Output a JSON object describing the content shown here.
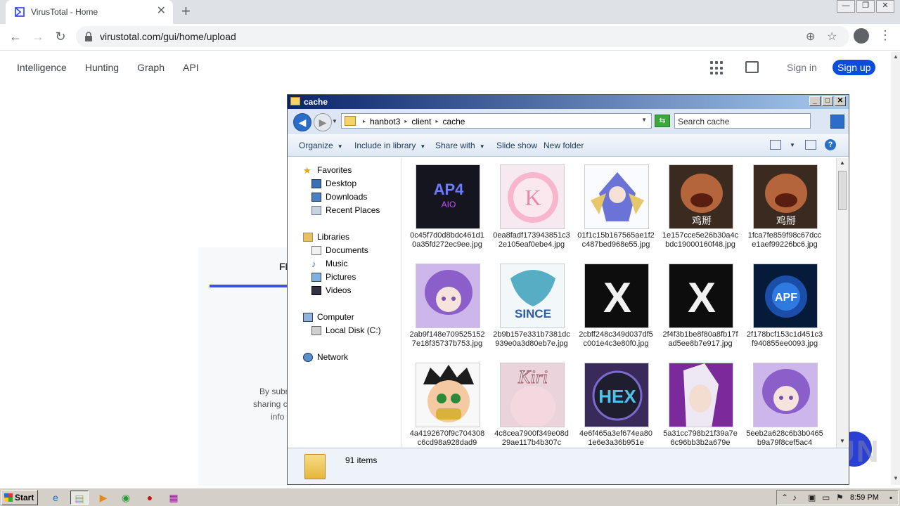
{
  "browser": {
    "tab_title": "VirusTotal - Home",
    "url": "virustotal.com/gui/home/upload"
  },
  "vt": {
    "nav": [
      "Intelligence",
      "Hunting",
      "Graph",
      "API"
    ],
    "signin": "Sign in",
    "signup": "Sign up",
    "card_heading": "FI",
    "text_lines": [
      "By subm",
      "sharing c",
      "info"
    ]
  },
  "explorer": {
    "title": "cache",
    "breadcrumb": [
      "hanbot3",
      "client",
      "cache"
    ],
    "search_placeholder": "Search cache",
    "commands": {
      "organize": "Organize",
      "include": "Include in library",
      "share": "Share with",
      "slideshow": "Slide show",
      "new_folder": "New folder"
    },
    "nav": {
      "favorites": "Favorites",
      "desktop": "Desktop",
      "downloads": "Downloads",
      "recent": "Recent Places",
      "libraries": "Libraries",
      "documents": "Documents",
      "music": "Music",
      "pictures": "Pictures",
      "videos": "Videos",
      "computer": "Computer",
      "local_disk": "Local Disk (C:)",
      "network": "Network"
    },
    "files": [
      {
        "name": "0c45f7d0d8bdc461d10a35fd272ec9ee.jpg",
        "thumb_text": "AP4"
      },
      {
        "name": "0ea8fadf173943851c32e105eaf0ebe4.jpg",
        "thumb_text": "K"
      },
      {
        "name": "01f1c15b167565ae1f2c487bed968e55.jpg",
        "thumb_text": ""
      },
      {
        "name": "1e157cce5e26b30a4cbdc19000160f48.jpg",
        "thumb_text": "鸡掰"
      },
      {
        "name": "1fca7fe859f98c67dcce1aef99226bc6.jpg",
        "thumb_text": "鸡掰"
      },
      {
        "name": "2ab9f148e7095251527e18f35737b753.jpg",
        "thumb_text": ""
      },
      {
        "name": "2b9b157e331b7381dc939e0a3d80eb7e.jpg",
        "thumb_text": "SINCE"
      },
      {
        "name": "2cbff248c349d037df5c001e4c3e80f0.jpg",
        "thumb_text": "X"
      },
      {
        "name": "2f4f3b1be8f80a8fb17fad5ee8b7e917.jpg",
        "thumb_text": "X"
      },
      {
        "name": "2f178bcf153c1d451c3f940855ee0093.jpg",
        "thumb_text": "APF"
      },
      {
        "name": "4a4192670f9c704308c6cd98a928dad9",
        "thumb_text": ""
      },
      {
        "name": "4c8cea7900f349e08d29ae117b4b307c",
        "thumb_text": "Kiri"
      },
      {
        "name": "4e6f465a3ef674ea801e6e3a36b951e",
        "thumb_text": "HEX"
      },
      {
        "name": "5a31cc798b21f39a7e6c96bb3b2a679e",
        "thumb_text": ""
      },
      {
        "name": "5eeb2a628c6b3b0465b9a79f8cef5ac4",
        "thumb_text": ""
      }
    ],
    "status": "91 items"
  },
  "taskbar": {
    "start": "Start",
    "time": "8:59 PM"
  },
  "watermark": "ANY RUN"
}
